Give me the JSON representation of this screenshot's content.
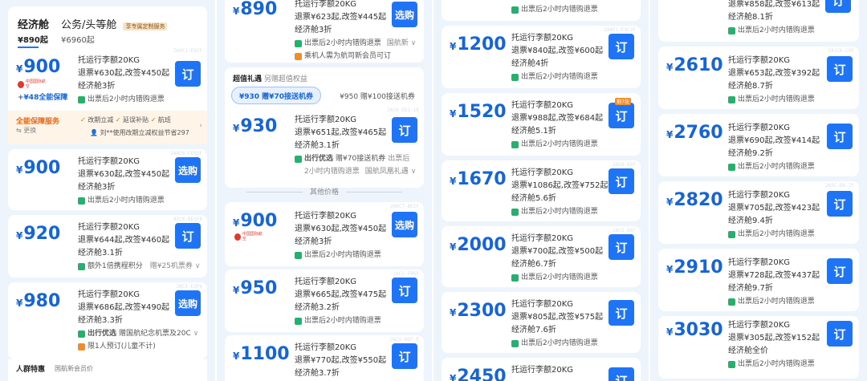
{
  "tabs": {
    "economy_label": "经济舱",
    "economy_price": "¥890起",
    "first_label": "公务/头等舱",
    "first_badge": "享专属定制服务",
    "first_price": "¥6960起"
  },
  "common": {
    "baggage": "托运行李额20KG",
    "refund_tip": "出票后2小时内错购退票",
    "order": "订",
    "buy": "选购",
    "yen": "¥"
  },
  "col1": [
    {
      "price": "900",
      "refund": "退票¥630起,改签¥450起",
      "disc": "经济舱3折",
      "btn": "订",
      "code": "ZA0C1-E92F",
      "plus": "+¥48全能保障",
      "logo": "中国国际航空"
    },
    {
      "price": "900",
      "refund": "退票¥630起,改签¥450起",
      "disc": "经济舱3折",
      "btn": "选购",
      "code": "2A8C6-CE93F"
    },
    {
      "price": "920",
      "refund": "退票¥644起,改签¥460起",
      "disc": "经济舱3.1折",
      "btn": "订",
      "code": "92C6-BE5F8",
      "tip": "额外1倍携程积分",
      "tip2": "赠¥25机票券"
    },
    {
      "price": "980",
      "refund": "退票¥686起,改签¥490起",
      "disc": "经济舱3.3折",
      "btn": "选购",
      "code": "2BC5-E3F6",
      "tip_title": "出行优选",
      "tip": "赠国航纪念机票及20C",
      "tip3": "限1人预订(儿童不计)"
    }
  ],
  "guarantee": {
    "title": "全能保障服务",
    "change": "更换",
    "items": [
      "改期立减",
      "延误补贴",
      "航班"
    ],
    "user_note": "刘**使用改期立减权益节省297"
  },
  "crowd": {
    "title": "人群特惠",
    "sub": "国航新会员价"
  },
  "col2": [
    {
      "price": "890",
      "refund": "退票¥623起,改签¥445起",
      "disc": "经济舱3折",
      "btn": "选购",
      "tip_a": "出票后2小时内错购退票",
      "tip_a2": "国航新",
      "tip_b": "乘机人需为航司新会员可订"
    },
    {
      "price": "930",
      "refund": "退票¥651起,改签¥465起",
      "disc": "经济舱3.1折",
      "btn": "订",
      "code": "2AC6-ED1-1E",
      "tip_title": "出行优选",
      "tip": "赠¥70接送机券",
      "tip2": "出票后",
      "tip3": "2小时内错购退票",
      "tip4": "国航凤凰礼遇"
    },
    {
      "price": "900",
      "refund": "退票¥630起,改签¥450起",
      "disc": "经济舱3折",
      "btn": "选购",
      "code": "2A6CT-BE2F",
      "logo": "中国国际航空"
    },
    {
      "price": "950",
      "refund": "退票¥665起,改签¥475起",
      "disc": "经济舱3.2折",
      "btn": "订",
      "code": "2AC5-FD6F"
    },
    {
      "price": "1100",
      "refund": "退票¥770起,改签¥550起",
      "disc": "经济舱3.7折",
      "btn": "订",
      "code": "2AC5-DDT-E"
    }
  ],
  "gift": {
    "title": "超值礼遇",
    "sub": "另赠超值权益",
    "opt1": "¥930 赠¥70接送机券",
    "opt2": "¥950 赠¥100接送机券"
  },
  "other_price": "其他价格",
  "col3": [
    {
      "price": "1200",
      "refund": "退票¥840起,改签¥600起",
      "disc": "经济舱4折",
      "btn": "订",
      "code": "ZA0C1-E9C2F"
    },
    {
      "price": "1520",
      "refund": "退票¥988起,改签¥684起",
      "disc": "经济舱5.1折",
      "btn": "订",
      "badge": "剩7张"
    },
    {
      "price": "1670",
      "refund": "退票¥1086起,改签¥752起",
      "disc": "经济舱5.6折",
      "btn": "订",
      "code": "2AC6-E6F"
    },
    {
      "price": "2000",
      "refund": "退票¥700起,改签¥500起",
      "disc": "经济舱6.7折",
      "btn": "订",
      "code": "2AC5-D6F"
    },
    {
      "price": "2300",
      "refund": "退票¥805起,改签¥575起",
      "disc": "经济舱7.6折",
      "btn": "订"
    },
    {
      "price": "2450",
      "btn": "订"
    }
  ],
  "col4": [
    {
      "refund": "退票¥858起,改签¥613起",
      "disc": "经济舱8.1折",
      "btn": "订"
    },
    {
      "price": "2610",
      "refund": "退票¥653起,改签¥392起",
      "disc": "经济舱8.7折",
      "btn": "订",
      "code": "2A1C6-C9F"
    },
    {
      "price": "2760",
      "refund": "退票¥690起,改签¥414起",
      "disc": "经济舱9.2折",
      "btn": "订"
    },
    {
      "price": "2820",
      "refund": "退票¥705起,改签¥423起",
      "disc": "经济舱9.4折",
      "btn": "订",
      "code": "2A5C-D6-7F"
    },
    {
      "price": "2910",
      "refund": "退票¥728起,改签¥437起",
      "disc": "经济舱9.7折",
      "btn": "订"
    },
    {
      "price": "3030",
      "refund": "退票¥305起,改签¥152起",
      "disc": "经济舱全价",
      "btn": "订"
    }
  ],
  "colors": {
    "accent": "#1e74f5",
    "price": "#1565d8",
    "green": "#23b26d",
    "orange": "#f28c28"
  }
}
